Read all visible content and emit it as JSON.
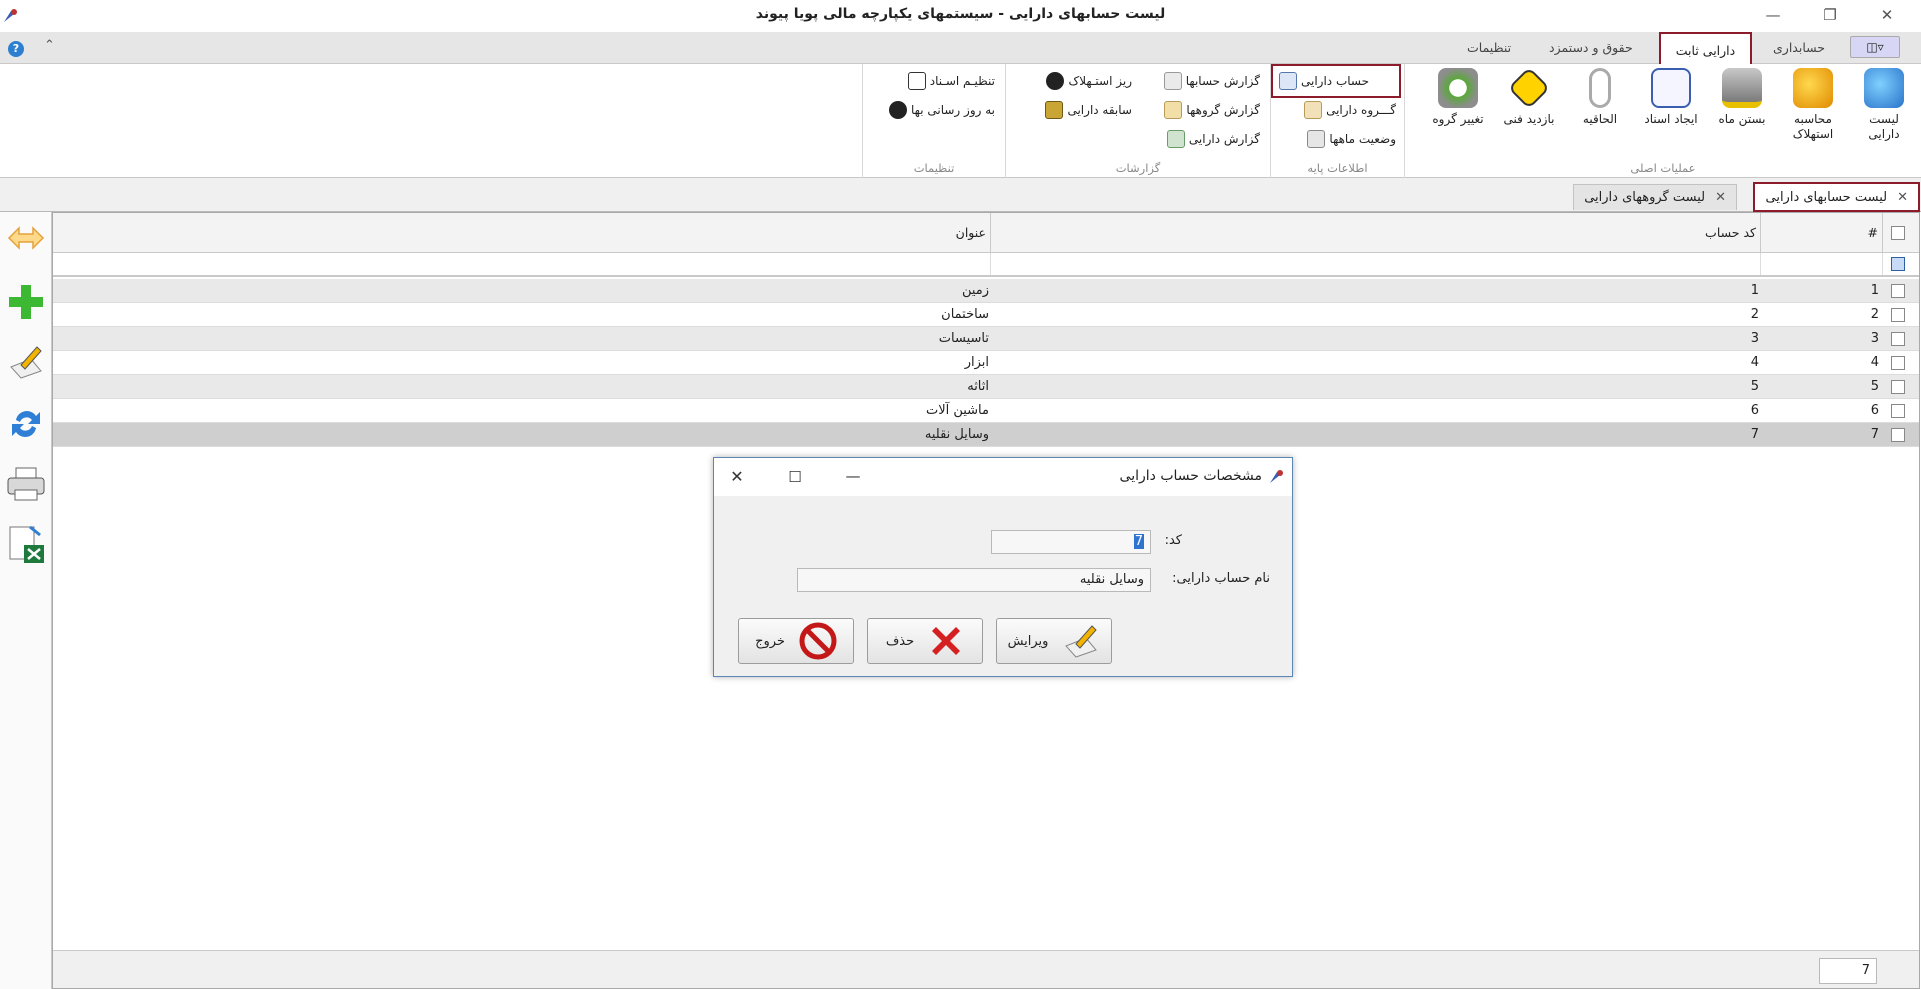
{
  "app": {
    "title": "لیست حسابهای دارایی - سیستمهای یکپارچه مالی پویا پیوند"
  },
  "ribbon_tabs": [
    {
      "label": "دارایی ثابت",
      "active": true
    },
    {
      "label": "حسابداری"
    },
    {
      "label": "حقوق و دستمزد"
    },
    {
      "label": "تنظیمات"
    }
  ],
  "ribbon": {
    "main_ops": {
      "label": "عملیات اصلی",
      "buttons": [
        {
          "label": "لیست دارایی",
          "icon": "list-icon"
        },
        {
          "label": "محاسبه استهلاک",
          "icon": "gears-icon"
        },
        {
          "label": "بستن ماه",
          "icon": "lock-icon"
        },
        {
          "label": "ایجاد اسناد",
          "icon": "document-icon"
        },
        {
          "label": "الحاقیه",
          "icon": "paperclip-icon"
        },
        {
          "label": "بازدید فنی",
          "icon": "tools-icon"
        },
        {
          "label": "تغییر گروه",
          "icon": "refresh-gear-icon"
        }
      ]
    },
    "base_info": {
      "label": "اطلاعات پایه",
      "buttons": [
        {
          "label": "حساب دارایی"
        },
        {
          "label": "گـــروه دارایی"
        },
        {
          "label": "وضعیت ماهها"
        }
      ]
    },
    "reports": {
      "label": "گزارشات",
      "buttons": [
        {
          "label": "گزارش حسابها"
        },
        {
          "label": "گزارش گروهها"
        },
        {
          "label": "گزارش دارایی"
        },
        {
          "label": "ریز استـهلاک"
        },
        {
          "label": "سابقه دارایی"
        }
      ]
    },
    "settings": {
      "label": "تنظیمات",
      "buttons": [
        {
          "label": "تنظیـم اسـناد"
        },
        {
          "label": "به روز رسانی بها"
        }
      ]
    }
  },
  "doc_tabs": [
    {
      "label": "لیست حسابهای دارایی",
      "active": true
    },
    {
      "label": "لیست گروههای دارایی"
    }
  ],
  "grid": {
    "columns": {
      "num": "#",
      "code": "کد حساب",
      "title": "عنوان"
    },
    "rows": [
      {
        "num": "1",
        "code": "1",
        "title": "زمین"
      },
      {
        "num": "2",
        "code": "2",
        "title": "ساختمان"
      },
      {
        "num": "3",
        "code": "3",
        "title": "تاسیسات"
      },
      {
        "num": "4",
        "code": "4",
        "title": "ابزار"
      },
      {
        "num": "5",
        "code": "5",
        "title": "اثاثه"
      },
      {
        "num": "6",
        "code": "6",
        "title": "ماشین آلات"
      },
      {
        "num": "7",
        "code": "7",
        "title": "وسایل نقلیه"
      }
    ],
    "footer_count": "7"
  },
  "dialog": {
    "title": "مشخصات حساب دارایی",
    "code_label": "کد:",
    "code_value": "7",
    "name_label": "نام حساب دارایی:",
    "name_value": "وسایل نقلیه",
    "edit_label": "ویرایش",
    "delete_label": "حذف",
    "exit_label": "خروج"
  },
  "colors": {
    "accent_border": "#8c1c2c",
    "selected_row": "#cfcfcf",
    "alt_row": "#e9e9e9"
  }
}
